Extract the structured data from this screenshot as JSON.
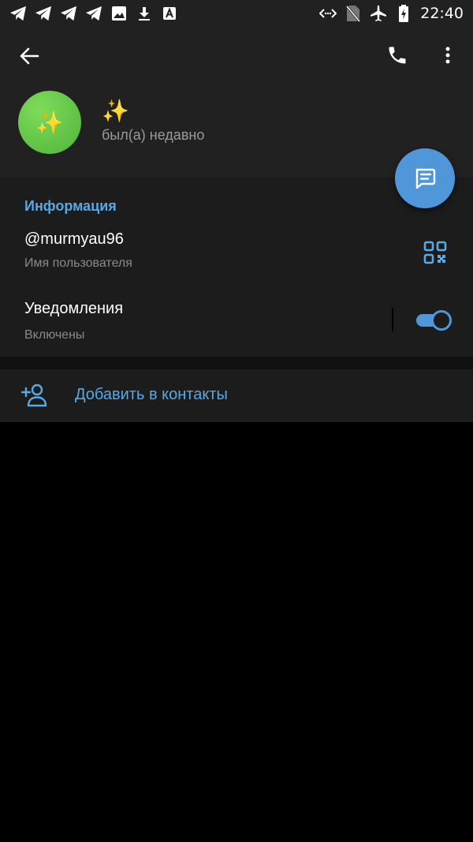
{
  "status_bar": {
    "time": "22:40",
    "left_icons": [
      "telegram-icon",
      "telegram-icon",
      "telegram-icon",
      "telegram-icon",
      "image-icon",
      "download-icon",
      "a-notification-icon"
    ],
    "right_icons": [
      "data-saver-icon",
      "no-sim-icon",
      "airplane-icon",
      "battery-charging-icon"
    ]
  },
  "header": {
    "name": "✨",
    "avatar_emoji": "✨",
    "last_seen": "был(а) недавно"
  },
  "info": {
    "section_title": "Информация",
    "username": "@murmyau96",
    "username_caption": "Имя пользователя",
    "notifications_label": "Уведомления",
    "notifications_state": "Включены",
    "notifications_enabled": true
  },
  "actions": {
    "add_contact_label": "Добавить в контакты"
  },
  "colors": {
    "accent": "#5aa8e6",
    "fab": "#4f97d9",
    "header_bg": "#212121",
    "section_bg": "#1c1c1c",
    "avatar": "#5cc443"
  }
}
